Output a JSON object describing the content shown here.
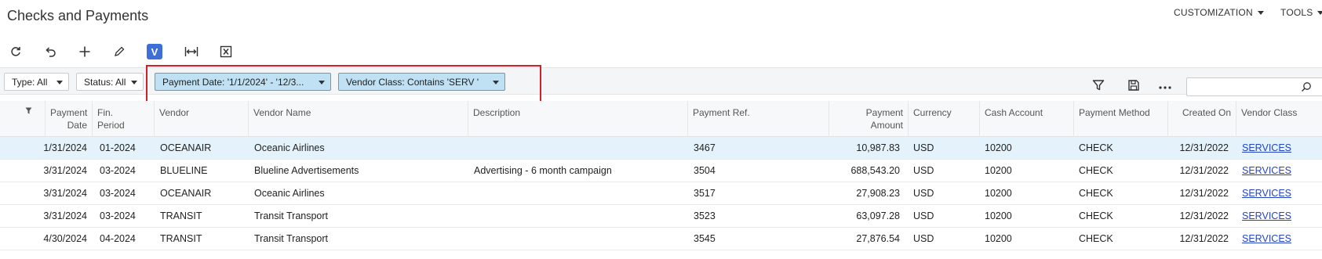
{
  "header": {
    "title": "Checks and Payments",
    "customization_label": "CUSTOMIZATION",
    "tools_label": "TOOLS"
  },
  "toolbar": {
    "icons": [
      "refresh-icon",
      "undo-icon",
      "add-icon",
      "edit-icon",
      "v-icon",
      "fit-width-icon",
      "export-excel-icon"
    ],
    "v_label": "V"
  },
  "filters": {
    "type": "Type: All",
    "status": "Status: All",
    "payment_date": "Payment Date: '1/1/2024' - '12/3...",
    "vendor_class": "Vendor Class: Contains 'SERV '"
  },
  "grid": {
    "columns": {
      "payment_date": [
        "Payment",
        "Date"
      ],
      "fin_period": [
        "Fin.",
        "Period"
      ],
      "vendor": "Vendor",
      "vendor_name": "Vendor Name",
      "description": "Description",
      "payment_ref": "Payment Ref.",
      "payment_amount": [
        "Payment",
        "Amount"
      ],
      "currency": "Currency",
      "cash_account": "Cash Account",
      "payment_method": "Payment Method",
      "created_on": "Created On",
      "vendor_class": "Vendor Class"
    },
    "rows": [
      {
        "payment_date": "1/31/2024",
        "fin_period": "01-2024",
        "vendor": "OCEANAIR",
        "vendor_name": "Oceanic Airlines",
        "description": "",
        "payment_ref": "3467",
        "payment_amount": "10,987.83",
        "currency": "USD",
        "cash_account": "10200",
        "payment_method": "CHECK",
        "created_on": "12/31/2022",
        "vendor_class": "SERVICES"
      },
      {
        "payment_date": "3/31/2024",
        "fin_period": "03-2024",
        "vendor": "BLUELINE",
        "vendor_name": "Blueline Advertisements",
        "description": "Advertising - 6 month campaign",
        "payment_ref": "3504",
        "payment_amount": "688,543.20",
        "currency": "USD",
        "cash_account": "10200",
        "payment_method": "CHECK",
        "created_on": "12/31/2022",
        "vendor_class": "SERVICES"
      },
      {
        "payment_date": "3/31/2024",
        "fin_period": "03-2024",
        "vendor": "OCEANAIR",
        "vendor_name": "Oceanic Airlines",
        "description": "",
        "payment_ref": "3517",
        "payment_amount": "27,908.23",
        "currency": "USD",
        "cash_account": "10200",
        "payment_method": "CHECK",
        "created_on": "12/31/2022",
        "vendor_class": "SERVICES"
      },
      {
        "payment_date": "3/31/2024",
        "fin_period": "03-2024",
        "vendor": "TRANSIT",
        "vendor_name": "Transit Transport",
        "description": "",
        "payment_ref": "3523",
        "payment_amount": "63,097.28",
        "currency": "USD",
        "cash_account": "10200",
        "payment_method": "CHECK",
        "created_on": "12/31/2022",
        "vendor_class": "SERVICES"
      },
      {
        "payment_date": "4/30/2024",
        "fin_period": "04-2024",
        "vendor": "TRANSIT",
        "vendor_name": "Transit Transport",
        "description": "",
        "payment_ref": "3545",
        "payment_amount": "27,876.54",
        "currency": "USD",
        "cash_account": "10200",
        "payment_method": "CHECK",
        "created_on": "12/31/2022",
        "vendor_class": "SERVICES"
      }
    ]
  },
  "colors": {
    "accent": "#3e6fd8",
    "selected_row": "#e3f2fb",
    "active_filter": "#bfe1f3",
    "highlight": "#d0202a",
    "link": "#2444c4"
  }
}
